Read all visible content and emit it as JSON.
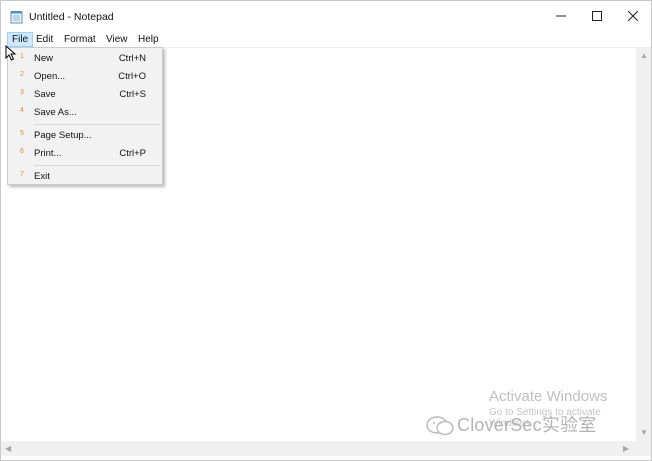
{
  "window": {
    "title": "Untitled - Notepad",
    "icons": {
      "app": "notepad-icon",
      "minimize": "minimize-icon",
      "maximize": "maximize-icon",
      "close": "close-icon"
    }
  },
  "menubar": {
    "items": [
      "File",
      "Edit",
      "Format",
      "View",
      "Help"
    ],
    "active": "File"
  },
  "file_menu": {
    "items": [
      {
        "num": "1",
        "label": "New",
        "shortcut": "Ctrl+N"
      },
      {
        "num": "2",
        "label": "Open...",
        "shortcut": "Ctrl+O"
      },
      {
        "num": "3",
        "label": "Save",
        "shortcut": "Ctrl+S"
      },
      {
        "num": "4",
        "label": "Save As...",
        "shortcut": ""
      },
      {
        "num": "5",
        "label": "Page Setup...",
        "shortcut": ""
      },
      {
        "num": "6",
        "label": "Print...",
        "shortcut": "Ctrl+P"
      },
      {
        "num": "7",
        "label": "Exit",
        "shortcut": ""
      }
    ]
  },
  "editor": {
    "content": ""
  },
  "watermark": {
    "activate_title": "Activate Windows",
    "activate_sub": "Go to Settings to activate Windows.",
    "brand": "CloverSec实验室"
  },
  "colors": {
    "menu_highlight": "#cce8ff",
    "menu_highlight_border": "#99d1ff",
    "dropdown_bg": "#f2f2f2",
    "access_key_number": "#d88a2b"
  }
}
